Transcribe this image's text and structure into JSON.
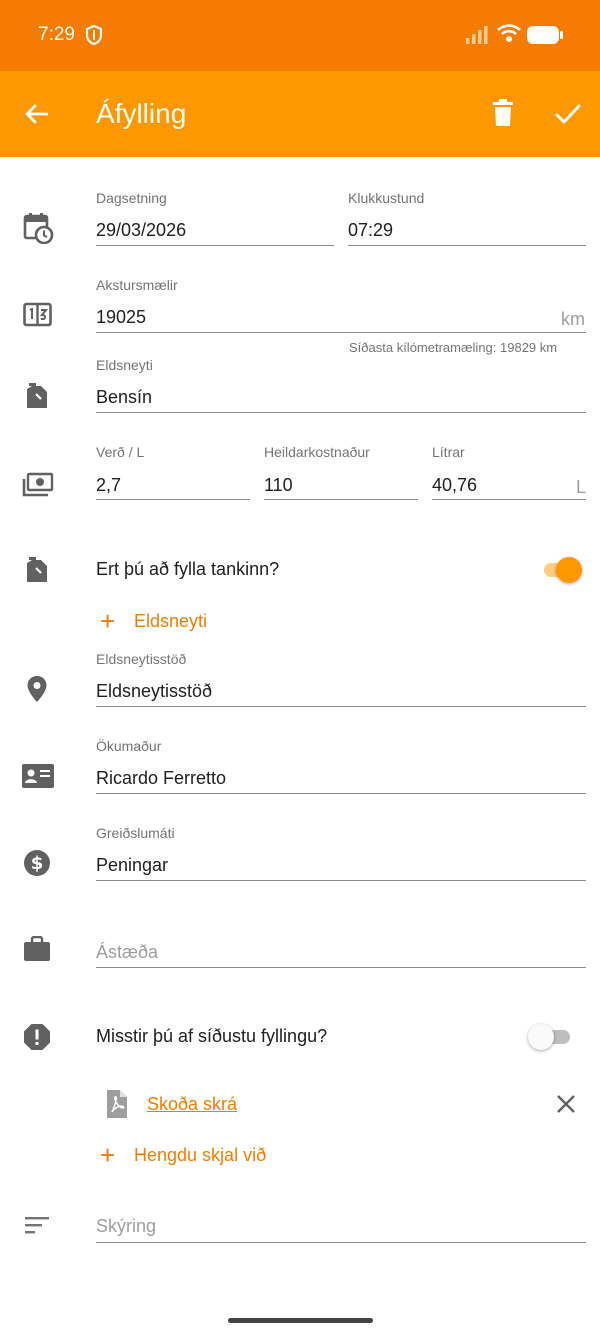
{
  "status_bar": {
    "time": "7:29"
  },
  "app_bar": {
    "title": "Áfylling"
  },
  "colors": {
    "accent": "#ff9800",
    "status_bar": "#f57c00",
    "icon_gray": "#616161"
  },
  "form": {
    "date": {
      "label": "Dagsetning",
      "value": "29/03/2026"
    },
    "time": {
      "label": "Klukkustund",
      "value": "07:29"
    },
    "odometer": {
      "label": "Akstursmælir",
      "value": "19025",
      "unit": "km",
      "hint": "Síðasta kílómetramæling: 19829 km"
    },
    "fuel": {
      "label": "Eldsneyti",
      "value": "Bensín"
    },
    "price": {
      "label": "Verð / L",
      "value": "2,7"
    },
    "total_cost": {
      "label": "Heildarkostnaður",
      "value": "110"
    },
    "liters": {
      "label": "Lítrar",
      "value": "40,76",
      "unit": "L"
    },
    "fill_tank": {
      "label": "Ert þú að fylla tankinn?",
      "on": true
    },
    "add_fuel_label": "Eldsneyti",
    "station": {
      "label": "Eldsneytisstöð",
      "value": "Eldsneytisstöð"
    },
    "driver": {
      "label": "Ökumaður",
      "value": "Ricardo Ferretto"
    },
    "payment": {
      "label": "Greiðslumáti",
      "value": "Peningar"
    },
    "reason": {
      "placeholder": "Ástæða"
    },
    "missed_fill": {
      "label": "Misstir þú af síðustu fyllingu?",
      "on": false
    },
    "attachment": {
      "link": "Skoða skrá"
    },
    "attach_label": "Hengdu skjal við",
    "notes": {
      "placeholder": "Skýring"
    }
  },
  "icons": [
    "back-arrow-icon",
    "trash-icon",
    "check-icon",
    "calendar-clock-icon",
    "odometer-icon",
    "fuel-can-icon",
    "money-icon",
    "location-pin-icon",
    "id-card-icon",
    "dollar-icon",
    "briefcase-icon",
    "alert-octagon-icon",
    "pdf-file-icon",
    "close-icon",
    "notes-icon",
    "plus-icon"
  ]
}
